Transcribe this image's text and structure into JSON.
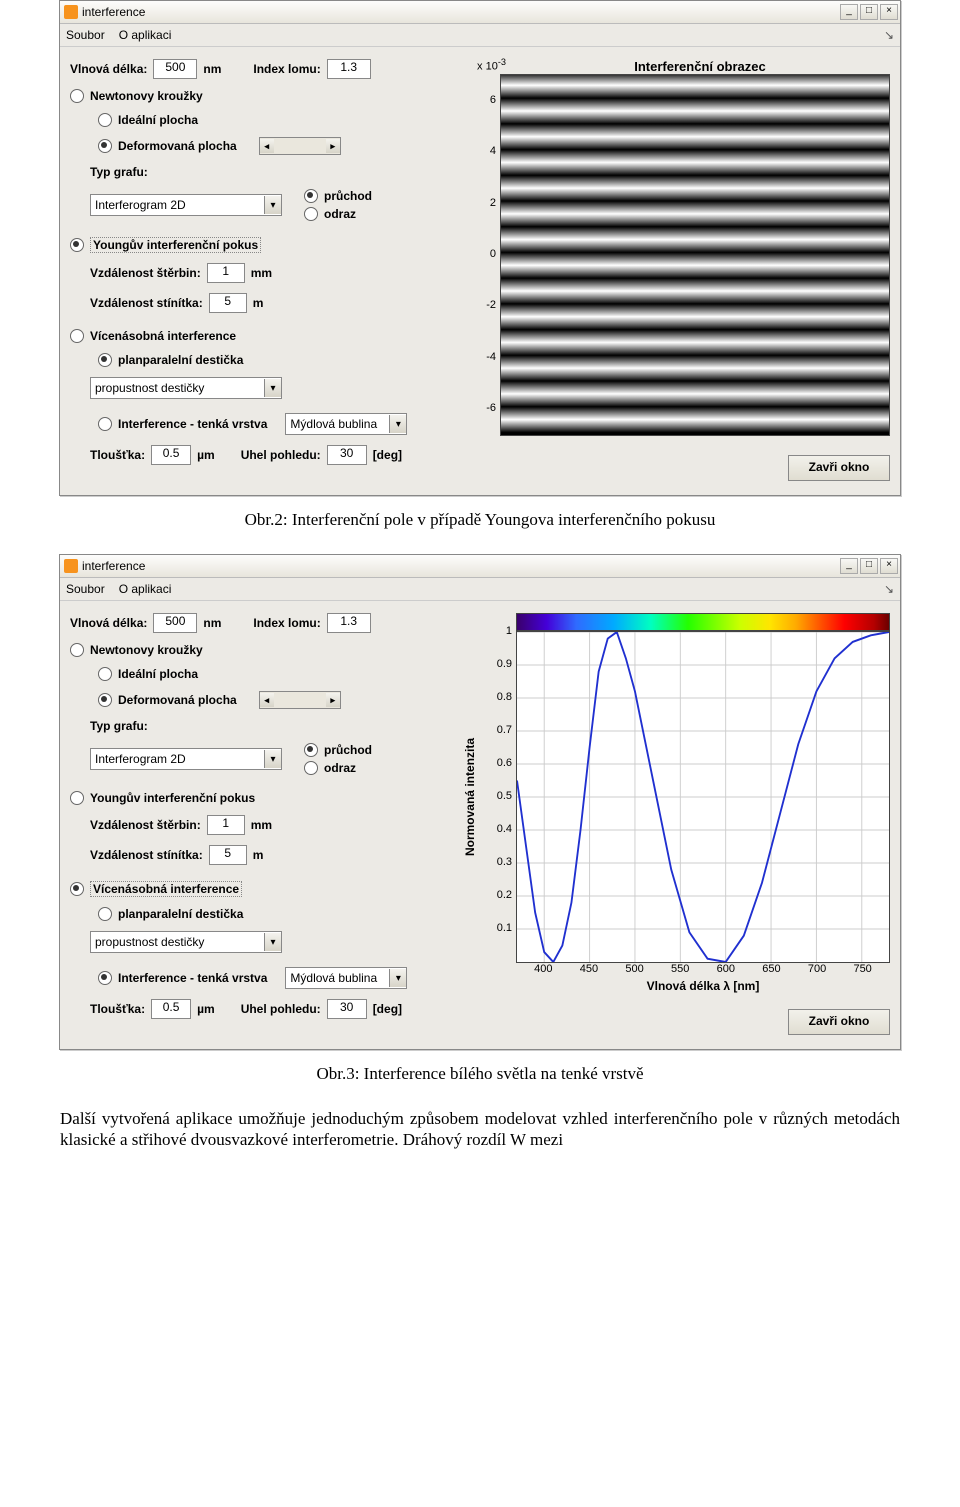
{
  "window": {
    "title": "interference",
    "menus": {
      "file": "Soubor",
      "about": "O aplikaci"
    }
  },
  "inputs": {
    "wavelength_label": "Vlnová délka:",
    "wavelength_value": "500",
    "wavelength_unit": "nm",
    "index_label": "Index lomu:",
    "index_value": "1.3",
    "newton": "Newtonovy kroužky",
    "ideal": "Ideální plocha",
    "deformed": "Deformovaná plocha",
    "graphtype_label": "Typ grafu:",
    "graphtype_value": "Interferogram 2D",
    "transmission": "průchod",
    "reflection": "odraz",
    "young": "Youngův interferenční pokus",
    "slit_dist_label": "Vzdálenost štěrbin:",
    "slit_dist_value": "1",
    "slit_dist_unit": "mm",
    "screen_dist_label": "Vzdálenost stínítka:",
    "screen_dist_value": "5",
    "screen_dist_unit": "m",
    "multi": "Vícenásobná interference",
    "planparallel": "planparalelní destička",
    "planparallel_opt": "propustnost destičky",
    "thinfilm": "Interference - tenká vrstva",
    "thinfilm_opt": "Mýdlová bublina",
    "thickness_label": "Tloušťka:",
    "thickness_value": "0.5",
    "thickness_unit": "µm",
    "angle_label": "Uhel pohledu:",
    "angle_value": "30",
    "angle_unit": "[deg]",
    "close": "Zavři okno"
  },
  "chart1": {
    "title": "Interferenční obrazec",
    "exp": "x 10",
    "exp_sup": "-3",
    "yticks": [
      "6",
      "4",
      "2",
      "0",
      "-2",
      "-4",
      "-6"
    ]
  },
  "chart2": {
    "ylabel": "Normovaná intenzita",
    "xlabel": "Vlnová délka λ [nm]",
    "yticks": [
      "1",
      "0.9",
      "0.8",
      "0.7",
      "0.6",
      "0.5",
      "0.4",
      "0.3",
      "0.2",
      "0.1"
    ],
    "xticks": [
      "400",
      "450",
      "500",
      "550",
      "600",
      "650",
      "700",
      "750"
    ]
  },
  "captions": {
    "c1": "Obr.2: Interferenční pole v případě Youngova interferenčního pokusu",
    "c2": "Obr.3: Interference bílého světla na tenké vrstvě"
  },
  "paragraph": "Další vytvořená aplikace umožňuje jednoduchým způsobem modelovat vzhled interferenčního pole v různých metodách klasické a střihové dvousvazkové interferometrie. Dráhový rozdíl  W  mezi",
  "chart_data": [
    {
      "type": "heatmap",
      "title": "Interferenční obrazec",
      "ylim": [
        -7,
        7
      ],
      "y_units_exponent": -3,
      "yticks": [
        6,
        4,
        2,
        0,
        -2,
        -4,
        -6
      ],
      "fringe_positions": [
        6.6,
        5.6,
        4.6,
        3.6,
        2.6,
        1.6,
        0.6,
        -0.4,
        -1.4,
        -2.4,
        -3.4,
        -4.4,
        -5.4,
        -6.4
      ],
      "description": "Horizontal cosine-squared interference fringes (bright bands) at the listed y positions (×10^-3), dark bands midway between."
    },
    {
      "type": "line",
      "title": "",
      "xlabel": "Vlnová délka λ [nm]",
      "ylabel": "Normovaná intenzita",
      "xlim": [
        370,
        780
      ],
      "ylim": [
        0,
        1
      ],
      "series": [
        {
          "name": "Normovaná intenzita",
          "color": "#2030d0",
          "x": [
            370,
            380,
            390,
            400,
            410,
            420,
            430,
            440,
            450,
            460,
            470,
            480,
            490,
            500,
            520,
            540,
            560,
            580,
            600,
            620,
            640,
            660,
            680,
            700,
            720,
            740,
            760,
            780
          ],
          "y": [
            0.55,
            0.35,
            0.15,
            0.03,
            0.0,
            0.05,
            0.18,
            0.4,
            0.65,
            0.88,
            0.98,
            1.0,
            0.92,
            0.82,
            0.55,
            0.28,
            0.09,
            0.01,
            0.0,
            0.08,
            0.24,
            0.45,
            0.66,
            0.82,
            0.92,
            0.97,
            0.99,
            1.0
          ]
        }
      ]
    }
  ]
}
